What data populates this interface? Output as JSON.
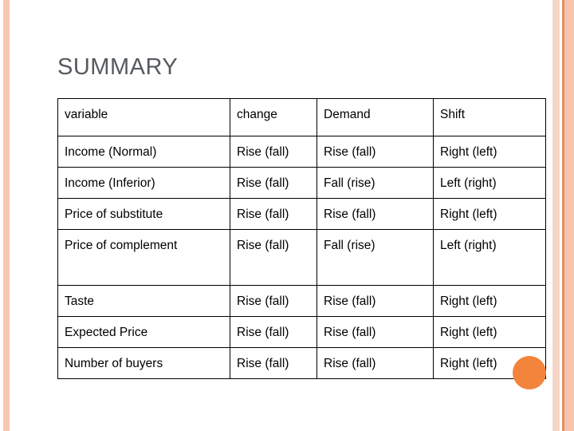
{
  "slide": {
    "title": "SUMMARY",
    "accent_colors": {
      "title_text": "#565a5e",
      "left_stripe": "#f8c8b0",
      "right_band_light": "#f5d5c6",
      "right_band_dark": "#e09060",
      "right_band_main": "#f9c4ac",
      "orange_dot": "#f3843c",
      "table_border": "#000000"
    }
  },
  "table": {
    "headers": [
      "variable",
      "change",
      "Demand",
      "Shift"
    ],
    "rows": [
      [
        "Income (Normal)",
        "Rise (fall)",
        "Rise (fall)",
        "Right (left)"
      ],
      [
        "Income (Inferior)",
        "Rise (fall)",
        "Fall (rise)",
        "Left (right)"
      ],
      [
        "Price of substitute",
        "Rise (fall)",
        "Rise (fall)",
        "Right (left)"
      ],
      [
        "Price of complement",
        "Rise (fall)",
        "Fall (rise)",
        "Left (right)"
      ],
      [
        "Taste",
        "Rise (fall)",
        "Rise (fall)",
        "Right (left)"
      ],
      [
        "Expected Price",
        "Rise (fall)",
        "Rise (fall)",
        "Right (left)"
      ],
      [
        "Number of buyers",
        "Rise (fall)",
        "Rise (fall)",
        "Right (left)"
      ]
    ]
  }
}
